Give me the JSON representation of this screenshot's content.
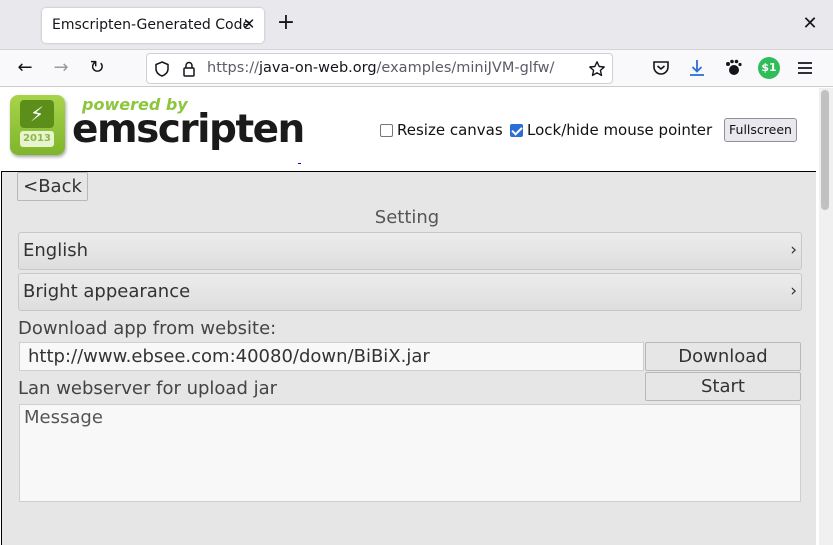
{
  "browser": {
    "tab_title": "Emscripten-Generated Code",
    "url_prefix": "https://",
    "url_host": "java-on-web.org",
    "url_path": "/examples/miniJVM-glfw/",
    "extension_badge": "$1"
  },
  "header": {
    "logo_powered": "powered by",
    "logo_name": "emscripten",
    "logo_year": "2013",
    "resize_canvas_label": "Resize canvas",
    "resize_canvas_checked": false,
    "lock_pointer_label": "Lock/hide mouse pointer",
    "lock_pointer_checked": true,
    "fullscreen_label": "Fullscreen"
  },
  "app": {
    "back_label": "<Back",
    "title": "Setting",
    "menu": [
      {
        "label": "English",
        "chevron": "›"
      },
      {
        "label": "Bright appearance",
        "chevron": "›"
      }
    ],
    "download_label": "Download app from website:",
    "download_url": "http://www.ebsee.com:40080/down/BiBiX.jar",
    "download_button": "Download",
    "lan_label": "Lan webserver for upload jar",
    "start_button": "Start",
    "message_placeholder": "Message"
  },
  "colors": {
    "accent": "#2b6fd6",
    "logo_green": "#8cc63f",
    "app_bg": "#e6e6e6"
  }
}
